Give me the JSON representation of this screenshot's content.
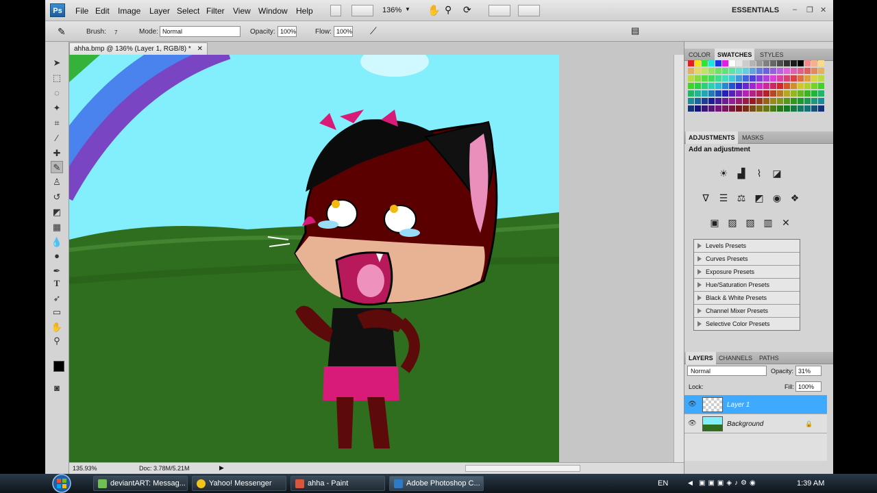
{
  "app": {
    "logo": "Ps",
    "menu": [
      "File",
      "Edit",
      "Image",
      "Layer",
      "Select",
      "Filter",
      "View",
      "Window",
      "Help"
    ],
    "zoom_display": "136%",
    "workspace": "ESSENTIALS"
  },
  "options": {
    "brush_label": "Brush:",
    "brush_size": "7",
    "mode_label": "Mode:",
    "mode_value": "Normal",
    "opacity_label": "Opacity:",
    "opacity_value": "100%",
    "flow_label": "Flow:",
    "flow_value": "100%"
  },
  "document": {
    "tab_title": "ahha.bmp @ 136% (Layer 1, RGB/8) *",
    "status_zoom": "135.93%",
    "status_doc": "Doc: 3.78M/5.21M"
  },
  "panels": {
    "color_tabs": [
      "COLOR",
      "SWATCHES",
      "STYLES"
    ],
    "adj_tabs": [
      "ADJUSTMENTS",
      "MASKS"
    ],
    "add_adjustment": "Add an adjustment",
    "presets": [
      "Levels Presets",
      "Curves Presets",
      "Exposure Presets",
      "Hue/Saturation Presets",
      "Black & White Presets",
      "Channel Mixer Presets",
      "Selective Color Presets"
    ],
    "layer_tabs": [
      "LAYERS",
      "CHANNELS",
      "PATHS"
    ],
    "blend_mode": "Normal",
    "opacity_label": "Opacity:",
    "opacity_value": "31%",
    "lock_label": "Lock:",
    "fill_label": "Fill:",
    "fill_value": "100%",
    "layers": [
      {
        "name": "Layer 1",
        "selected": true
      },
      {
        "name": "Background",
        "selected": false
      }
    ]
  },
  "taskbar": {
    "tasks": [
      {
        "label": "deviantART: Messag...",
        "icon_color": "#6fbf56"
      },
      {
        "label": "Yahoo! Messenger",
        "icon_color": "#f2c31b"
      },
      {
        "label": "ahha - Paint",
        "icon_color": "#d9553b"
      },
      {
        "label": "Adobe Photoshop C...",
        "icon_color": "#2d7bc4"
      }
    ],
    "lang": "EN",
    "time": "1:39 AM"
  },
  "colors": {
    "selected_layer": "#3da9ff",
    "sky": "#83eefc",
    "grass": "#2f6e1e"
  }
}
